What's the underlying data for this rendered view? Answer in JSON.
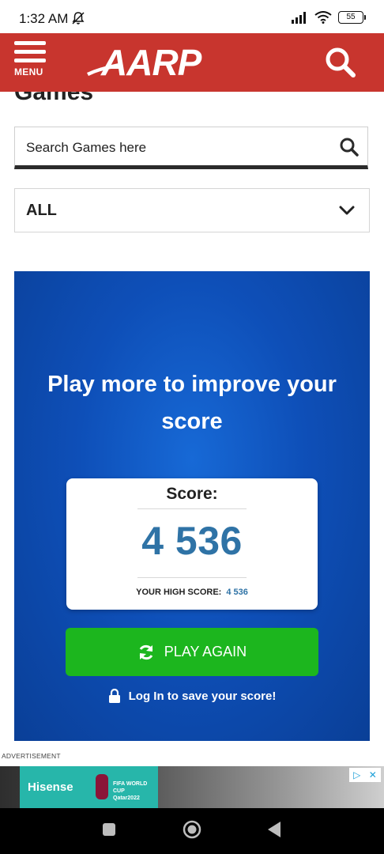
{
  "status_bar": {
    "time": "1:32 AM",
    "battery": "55"
  },
  "header": {
    "menu_label": "MENU",
    "logo_text": "AARP"
  },
  "page": {
    "title": "Games"
  },
  "search": {
    "placeholder": "Search Games here"
  },
  "filter": {
    "selected": "ALL"
  },
  "game": {
    "message": "Play more to improve your score",
    "score_label": "Score:",
    "score_value": "4 536",
    "high_score_label": "YOUR HIGH SCORE:",
    "high_score_value": "4 536",
    "play_again_label": "PLAY AGAIN",
    "login_text": "Log In to save your score!"
  },
  "advertisement": {
    "label": "ADVERTISEMENT",
    "brand": "Hisense",
    "event": "FIFA WORLD CUP Qatar2022"
  },
  "colors": {
    "header_red": "#c8352e",
    "panel_blue": "#0e4fb8",
    "play_green": "#1cb61e",
    "score_blue": "#2f73a6"
  }
}
